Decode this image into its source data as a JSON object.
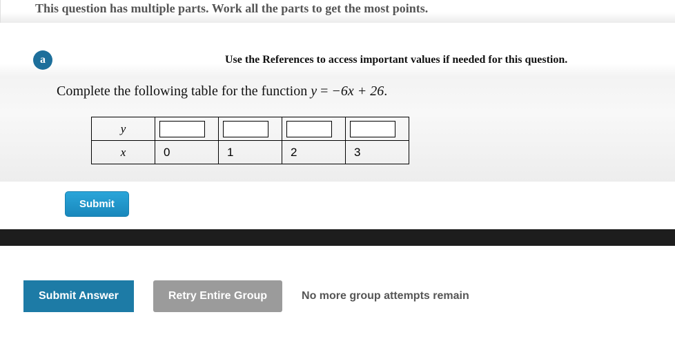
{
  "banner": {
    "text": "This question has multiple parts. Work all the parts to get the most points."
  },
  "part": {
    "label": "a",
    "reference_text": "Use the References to access important values if needed for this question.",
    "prompt_prefix": "Complete the following table for the function ",
    "prompt_equation_var": "y",
    "prompt_equation_eq": " = ",
    "prompt_equation_rhs": "−6x + 26",
    "prompt_suffix": "."
  },
  "table": {
    "row_y_label": "y",
    "row_x_label": "x",
    "x_values": [
      "0",
      "1",
      "2",
      "3"
    ],
    "y_values": [
      "",
      "",
      "",
      ""
    ]
  },
  "buttons": {
    "submit": "Submit",
    "submit_answer": "Submit Answer",
    "retry": "Retry Entire Group"
  },
  "status": {
    "no_more": "No more group attempts remain"
  }
}
